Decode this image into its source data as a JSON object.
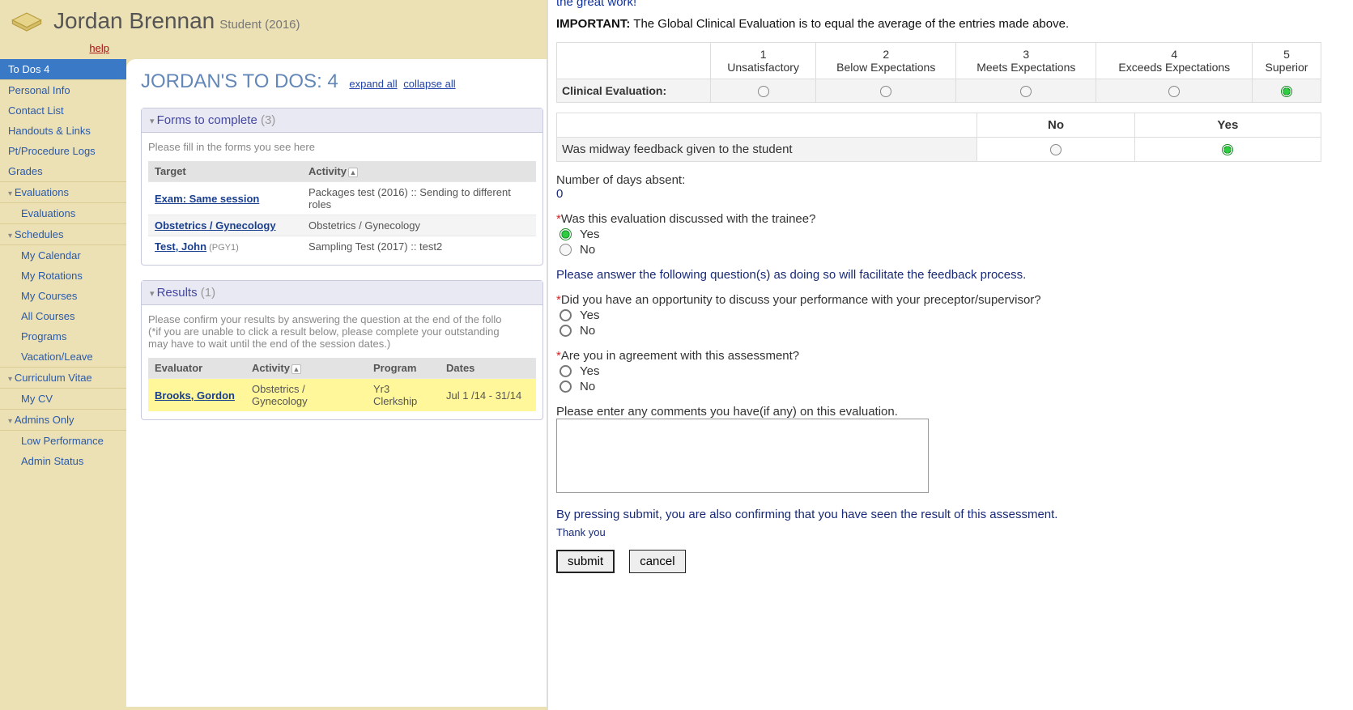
{
  "header": {
    "name": "Jordan Brennan",
    "role": "Student (2016)",
    "help": "help"
  },
  "sidebar": {
    "items": [
      {
        "label": "To Dos 4",
        "type": "active"
      },
      {
        "label": "Personal Info",
        "type": "plain"
      },
      {
        "label": "Contact List",
        "type": "plain"
      },
      {
        "label": "Handouts & Links",
        "type": "plain"
      },
      {
        "label": "Pt/Procedure Logs",
        "type": "plain"
      },
      {
        "label": "Grades",
        "type": "plain"
      },
      {
        "label": "Evaluations",
        "type": "head"
      },
      {
        "label": "Evaluations",
        "type": "sub"
      },
      {
        "label": "Schedules",
        "type": "head"
      },
      {
        "label": "My Calendar",
        "type": "sub"
      },
      {
        "label": "My Rotations",
        "type": "sub"
      },
      {
        "label": "My Courses",
        "type": "sub"
      },
      {
        "label": "All Courses",
        "type": "sub"
      },
      {
        "label": "Programs",
        "type": "sub"
      },
      {
        "label": "Vacation/Leave",
        "type": "sub"
      },
      {
        "label": "Curriculum Vitae",
        "type": "head"
      },
      {
        "label": "My CV",
        "type": "sub"
      },
      {
        "label": "Admins Only",
        "type": "head"
      },
      {
        "label": "Low Performance",
        "type": "sub"
      },
      {
        "label": "Admin Status",
        "type": "sub"
      }
    ]
  },
  "todos": {
    "title": "JORDAN'S TO DOS: 4",
    "expand": "expand all",
    "collapse": "collapse all"
  },
  "forms_panel": {
    "title": "Forms to complete",
    "count": "(3)",
    "hint": "Please fill in the forms you see here",
    "cols": {
      "target": "Target",
      "activity": "Activity"
    },
    "rows": [
      {
        "target": "Exam: Same session",
        "activity": "Packages test (2016) :: Sending to different roles"
      },
      {
        "target": "Obstetrics / Gynecology",
        "activity": "Obstetrics / Gynecology"
      },
      {
        "target": "Test, John",
        "pgy": "(PGY1)",
        "activity": "Sampling Test (2017) :: test2"
      }
    ]
  },
  "results_panel": {
    "title": "Results",
    "count": "(1)",
    "hint": "Please confirm your results by answering the question at the end of the follo\n(*if you are unable to click a result below, please complete your outstanding\nmay have to wait until the end of the session dates.)",
    "cols": {
      "evaluator": "Evaluator",
      "activity": "Activity",
      "program": "Program",
      "dates": "Dates"
    },
    "rows": [
      {
        "evaluator": "Brooks, Gordon",
        "activity": "Obstetrics / Gynecology",
        "program": "Yr3 Clerkship",
        "dates": "Jul 1 /14 - 31/14"
      }
    ]
  },
  "right": {
    "cutoff": "the great work!",
    "important_label": "IMPORTANT:",
    "important_text": "The Global Clinical Evaluation is to equal the average of the entries made above.",
    "scale": [
      {
        "n": "1",
        "t": "Unsatisfactory"
      },
      {
        "n": "2",
        "t": "Below Expectations"
      },
      {
        "n": "3",
        "t": "Meets Expectations"
      },
      {
        "n": "4",
        "t": "Exceeds Expectations"
      },
      {
        "n": "5",
        "t": "Superior"
      }
    ],
    "clin_label": "Clinical Evaluation:",
    "clin_selected_index": 4,
    "yesno_cols": {
      "no": "No",
      "yes": "Yes"
    },
    "midway_q": "Was midway feedback given to the student",
    "midway_sel": "yes",
    "absent_label": "Number of days absent:",
    "absent_value": "0",
    "discussed_q": "Was this evaluation discussed with the trainee?",
    "discussed_yes": "Yes",
    "discussed_no": "No",
    "fb_intro": "Please answer the following question(s) as doing so will facilitate the feedback process.",
    "q_opportunity": "Did you have an opportunity to discuss your performance with your preceptor/supervisor?",
    "q_agree": "Are you in agreement with this assessment?",
    "opt_yes": "Yes",
    "opt_no": "No",
    "comments_label": "Please enter any comments you have(if any) on this evaluation.",
    "confirm": "By pressing submit, you are also confirming that you have seen the result of this assessment.",
    "thanks": "Thank you",
    "submit": "submit",
    "cancel": "cancel"
  }
}
